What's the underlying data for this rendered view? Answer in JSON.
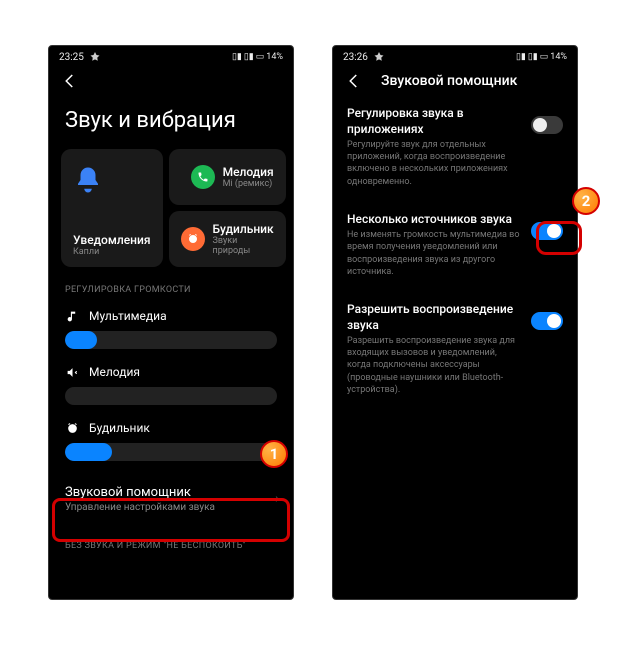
{
  "left": {
    "status": {
      "time": "23:25",
      "battery": "14%"
    },
    "page_title": "Звук и вибрация",
    "tiles": {
      "notifications": {
        "label": "Уведомления",
        "sub": "Капли"
      },
      "ringtone": {
        "label": "Мелодия",
        "sub": "Mi (ремикс)"
      },
      "alarm": {
        "label": "Будильник",
        "sub": "Звуки природы"
      }
    },
    "volume_header": "РЕГУЛИРОВКА ГРОМКОСТИ",
    "sliders": {
      "media": {
        "label": "Мультимедиа",
        "value_pct": 15
      },
      "ringtone": {
        "label": "Мелодия",
        "value_pct": 0
      },
      "alarm": {
        "label": "Будильник",
        "value_pct": 22
      }
    },
    "assistant": {
      "title": "Звуковой помощник",
      "sub": "Управление настройками звука"
    },
    "dnd_header": "БЕЗ ЗВУКА И РЕЖИМ \"НЕ БЕСПОКОИТЬ\"",
    "badge_1": "1"
  },
  "right": {
    "status": {
      "time": "23:26",
      "battery": "14%"
    },
    "header_title": "Звуковой помощник",
    "rows": {
      "app_volume": {
        "title": "Регулировка звука в приложениях",
        "desc": "Регулируйте звук для отдельных приложений, когда воспроизведение включено в нескольких приложениях одновременно.",
        "on": false
      },
      "multi_source": {
        "title": "Несколько источников звука",
        "desc": "Не изменять громкость мультимедиа во время получения уведомлений или воспроизведения звука из другого источника.",
        "on": true
      },
      "allow_playback": {
        "title": "Разрешить воспроизведение звука",
        "desc": "Разрешить воспроизведение звука для входящих вызовов и уведомлений, когда подключены аксессуары (проводные наушники или Bluetooth-устройства).",
        "on": true
      }
    },
    "badge_2": "2"
  },
  "colors": {
    "accent": "#0a84ff",
    "highlight": "#d40000",
    "badge_fill": "#ff7b00"
  }
}
